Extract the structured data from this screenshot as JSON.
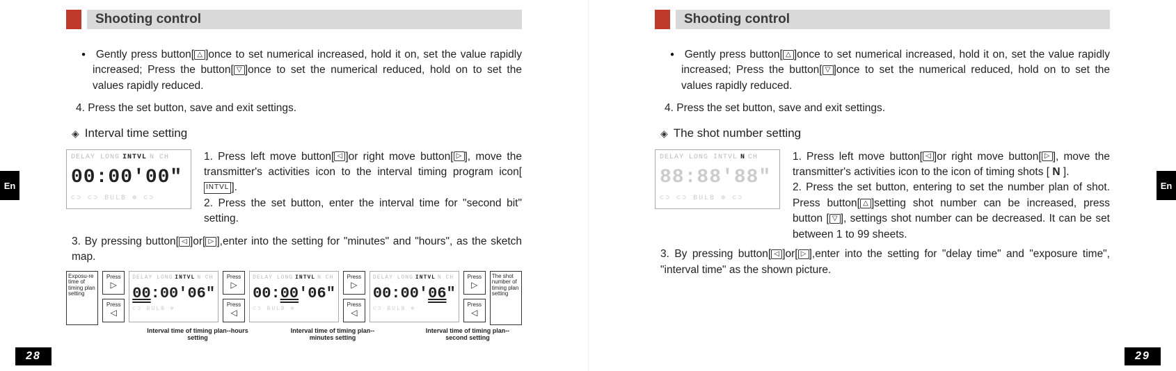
{
  "left": {
    "title": "Shooting control",
    "bullet1a": "Gently press button[",
    "bullet1b": "]once to set numerical increased, hold  it on, set the value rapidly increased; Press the button[",
    "bullet1c": "]once to set the  numerical  reduced, hold on to set  the values rapidly reduced.",
    "step4": "4.   Press the set button, save and exit settings.",
    "subhead": "Interval time  setting",
    "lcd1_top_pre": "DELAY LONG",
    "lcd1_top_hi": "INTVL",
    "lcd1_top_post": "N  CH",
    "lcd1_digits": "00:00'00\"",
    "lcd1_bottom": "⊂⊃ ⊂⊃ BULB ⊕ ⊂⊃",
    "p1a": "1.  Press left move button[",
    "p1b": "]or right move button[",
    "p1c": "], move the transmitter's activities icon to the interval timing program icon[",
    "intvl_label": "INTVL",
    "p1d": "].",
    "p2": "2. Press the set button, enter the interval  time for \"second bit\" setting.",
    "p3a": "3.  By pressing button[",
    "p3b": "]or[",
    "p3c": "],enter into the setting for \"minutes\" and \"hours\", as the sketch map.",
    "endbox_left": "Exposu-re time of timing plan setting",
    "press_label": "Press",
    "sm_top_pre": "DELAY LONG",
    "sm_top_hi": "INTVL",
    "sm_top_post": "N CH",
    "sm1_digs_a": "00",
    "sm1_digs_b": ":00'06\"",
    "sm2_digs_a": "00:",
    "sm2_digs_b": "00",
    "sm2_digs_c": "'06\"",
    "sm3_digs_a": "00:00'",
    "sm3_digs_b": "06",
    "sm3_digs_c": "\"",
    "sm_bottom": "⊂⊃ BULB ⊕",
    "endbox_right": "The shot number of timing plan setting",
    "cap1": "Interval time of timing plan--hours setting",
    "cap2": "Interval time of timing plan--minutes setting",
    "cap3": "Interval time of timing plan--second setting",
    "edge": "En",
    "pagenum": "28"
  },
  "right": {
    "title": "Shooting control",
    "bullet1a": "Gently press button[",
    "bullet1b": "]once to set numerical increased, hold  it on, set the value rapidly increased; Press the button[",
    "bullet1c": "]once to set the  numerical  reduced, hold on to set  the values rapidly reduced.",
    "step4": "4.   Press the set button, save and exit settings.",
    "subhead": "The shot number setting",
    "lcd1_top_pre": "DELAY LONG INTVL",
    "lcd1_top_hi": "N",
    "lcd1_top_post": "CH",
    "lcd1_digits_gray": "88:88'88\"",
    "lcd1_bottom": "⊂⊃ ⊂⊃ BULB ⊕ ⊂⊃",
    "p1a": "1.  Press left move button[",
    "p1b": "]or right move button[",
    "p1c": "], move the transmitter's activities icon to the icon of timing shots [",
    "n_label": "N",
    "p1d": "].",
    "p2a": "2.   Press the set button, entering to set the number plan of  shot.  Press  button[",
    "p2b": "]setting  shot  number  can  be increased, press button [",
    "p2c": "], settings shot number can be decreased. It can be set between 1 to 99 sheets.",
    "p3a": "3.  By pressing button[",
    "p3b": "]or[",
    "p3c": "],enter into the setting for  \"delay time\" and \"exposure time\", \"interval time\" as the shown picture.",
    "edge": "En",
    "pagenum": "29"
  }
}
